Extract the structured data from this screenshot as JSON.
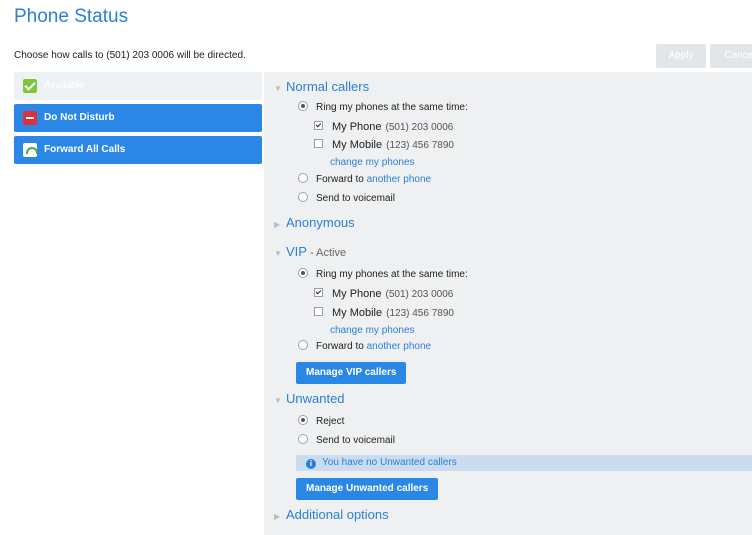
{
  "header": {
    "title": "Phone Status",
    "intro": "Choose how calls to (501) 203 0006 will be directed.",
    "apply_label": "Apply",
    "cancel_label": "Cancel"
  },
  "sidebar": {
    "items": [
      {
        "label": "Available",
        "icon": "check-icon"
      },
      {
        "label": "Do Not Disturb",
        "icon": "no-entry-icon"
      },
      {
        "label": "Forward All Calls",
        "icon": "forward-call-icon"
      }
    ]
  },
  "sections": {
    "normal": {
      "title": "Normal callers",
      "ring_label": "Ring my phones at the same time:",
      "phone1_name": "My Phone",
      "phone1_number": "(501) 203 0006",
      "phone2_name": "My Mobile",
      "phone2_number": "(123) 456 7890",
      "change_link": "change my phones",
      "forward_prefix": "Forward to",
      "forward_link": "another phone",
      "voicemail_label": "Send to voicemail"
    },
    "anonymous": {
      "title": "Anonymous"
    },
    "vip": {
      "title": "VIP",
      "status": " - Active",
      "ring_label": "Ring my phones at the same time:",
      "phone1_name": "My Phone",
      "phone1_number": "(501) 203 0006",
      "phone2_name": "My Mobile",
      "phone2_number": "(123) 456 7890",
      "change_link": "change my phones",
      "forward_prefix": "Forward to",
      "forward_link": "another phone",
      "manage_label": "Manage VIP callers"
    },
    "unwanted": {
      "title": "Unwanted",
      "reject_label": "Reject",
      "voicemail_label": "Send to voicemail",
      "info_text": "You have no Unwanted callers",
      "manage_label": "Manage Unwanted callers"
    },
    "additional": {
      "title": "Additional options"
    }
  }
}
